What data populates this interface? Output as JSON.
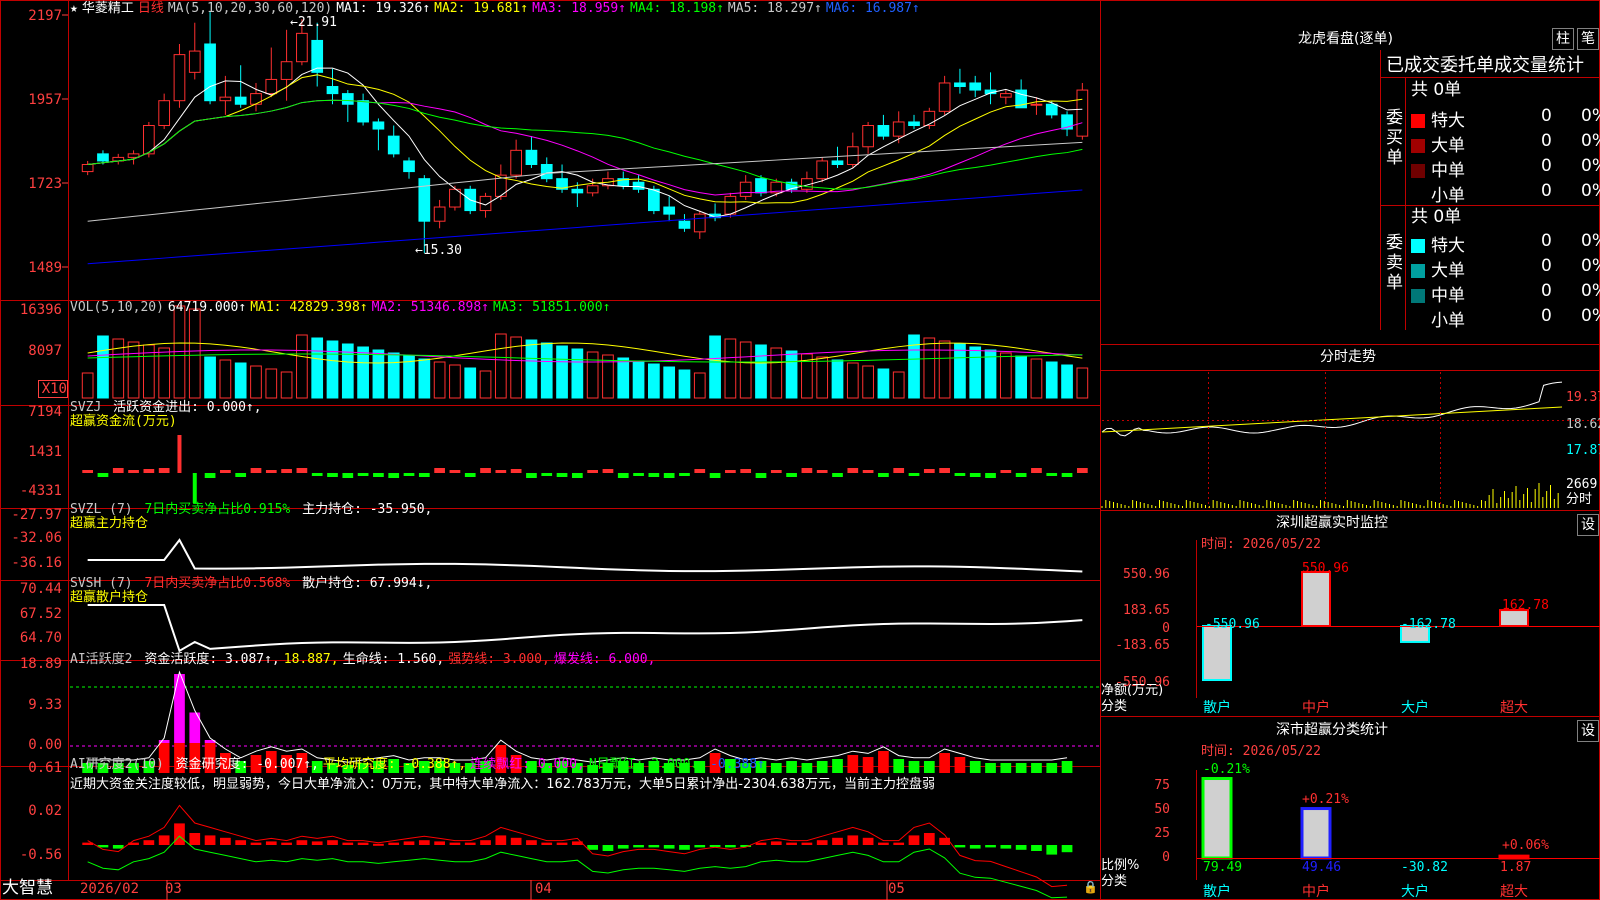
{
  "main_header": {
    "stock_name": "华菱精工",
    "period": "日线",
    "ma_label": "MA(5,10,20,30,60,120)",
    "ma1": "MA1: 19.326↑",
    "ma2": "MA2: 19.681↑",
    "ma3": "MA3: 18.959↑",
    "ma4": "MA4: 18.198↑",
    "ma5": "MA5: 18.297↑",
    "ma6": "MA6: 16.987↑",
    "high_marker": "21.91",
    "low_marker": "15.30"
  },
  "price_axis": [
    "2197",
    "1957",
    "1723",
    "1489"
  ],
  "vol_header": {
    "label": "VOL(5,10,20)",
    "v": "64719.000↑",
    "ma1": "MA1: 42829.398↑",
    "ma2": "MA2: 51346.898↑",
    "ma3": "MA3: 51851.000↑"
  },
  "vol_axis": [
    "16396",
    "8097",
    "X10"
  ],
  "svzj_header": {
    "label": "SVZJ",
    "t1": "活跃资金进出: 0.000↑,",
    "t2": "超赢资金流(万元)"
  },
  "svzj_axis": [
    "7194",
    "1431",
    "-4331"
  ],
  "svzl_header": {
    "label": "SVZL (7)",
    "t1": "7日内买卖净占比0.915%",
    "t2": "主力持仓: -35.950,",
    "t3": "超赢主力持仓"
  },
  "svzl_axis": [
    "-27.97",
    "-32.06",
    "-36.16"
  ],
  "svsh_header": {
    "label": "SVSH (7)",
    "t1": "7日内买卖净占比0.568%",
    "t2": "散户持仓: 67.994↓,",
    "t3": "超赢散户持仓"
  },
  "svsh_axis": [
    "70.44",
    "67.52",
    "64.70"
  ],
  "ai1_header": {
    "label": "AI活跃度2",
    "t1": "资金活跃度: 3.087↑,",
    "t2": "18.887,",
    "t3": "生命线: 1.560,",
    "t4": "强势线: 3.000,",
    "t5": "爆发线: 6.000,"
  },
  "ai1_axis": [
    "18.89",
    "9.33",
    "0.00"
  ],
  "ai2_header": {
    "label": "AI研究度2(10)",
    "t1": "资金研究度: -0.007↑,",
    "t2": "平均研究度: -0.388↑,",
    "t3": "连续飘红: 0.000,",
    "t4": "N日飘红: 2.000↓,",
    "t5": "-0.388↑"
  },
  "ai2_axis": [
    "0.61",
    "0.02",
    "-0.56"
  ],
  "ai2_comment": "近期大资金关注度较低，明显弱势，今日大单净流入：0万元，其中特大单净流入：162.783万元，大单5日累计净出-2304.638万元，当前主力控盘弱",
  "bottom_axis": {
    "brand": "大智慧",
    "d1": "2026/02",
    "d2": "03",
    "d3": "04",
    "d4": "05"
  },
  "right": {
    "lhb_title": "龙虎看盘(逐单)",
    "btn_col": "柱",
    "btn_pen": "笔",
    "tabs": "已成交委托单成交量统计",
    "buy_label": "委买单",
    "sell_label": "委卖单",
    "buy_total": "共 0单",
    "sell_total": "共 0单",
    "buy_rows": [
      {
        "label": "特大",
        "v": "0",
        "p": "0%",
        "color": "#ff0000"
      },
      {
        "label": "大单",
        "v": "0",
        "p": "0%",
        "color": "#a00000"
      },
      {
        "label": "中单",
        "v": "0",
        "p": "0%",
        "color": "#700000"
      },
      {
        "label": "小单",
        "v": "0",
        "p": "0%",
        "color": "#000000"
      }
    ],
    "sell_rows": [
      {
        "label": "特大",
        "v": "0",
        "p": "0%",
        "color": "#00ffff"
      },
      {
        "label": "大单",
        "v": "0",
        "p": "0%",
        "color": "#00a0a0"
      },
      {
        "label": "中单",
        "v": "0",
        "p": "0%",
        "color": "#007878"
      },
      {
        "label": "小单",
        "v": "0",
        "p": "0%",
        "color": "#000000"
      }
    ],
    "fenshi_title": "分时走势",
    "fenshi_axis": [
      "19.37",
      "18.62",
      "17.87",
      "2669",
      "分时"
    ],
    "sz_monitor_title": "深圳超赢实时监控",
    "sz_time": "时间: 2026/05/22",
    "sz_btn": "设",
    "sz_axis": [
      "550.96",
      "183.65",
      "0",
      "-183.65",
      "-550.96"
    ],
    "sz_labels": {
      "a": "净额(万元)",
      "b": "分类"
    },
    "sz_values": [
      "-550.96",
      "550.96",
      "-162.78",
      "162.78"
    ],
    "sz_cats": [
      "散户",
      "中户",
      "大户",
      "超大"
    ],
    "class_title": "深市超赢分类统计",
    "class_time": "时间: 2026/05/22",
    "class_btn": "设",
    "class_axis": [
      "75",
      "50",
      "25",
      "0"
    ],
    "class_labels": {
      "a": "比例%",
      "b": "分类"
    },
    "class_top": [
      "-0.21%",
      "+0.21%",
      "",
      "+0.06%"
    ],
    "class_values": [
      "79.49",
      "49.46",
      "-30.82",
      "1.87"
    ],
    "class_cats": [
      "散户",
      "中户",
      "大户",
      "超大"
    ]
  },
  "colors": {
    "up": "#ff3030",
    "down": "#00ffff",
    "frame": "#c00000",
    "ma1": "#ffffff",
    "ma2": "#ffff00",
    "ma3": "#ff00ff",
    "ma4": "#00ff00",
    "ma5": "#c8c8c8",
    "ma6": "#0000ff"
  },
  "chart_data": {
    "type": "candlestick",
    "title": "华菱精工 日线",
    "ylim": [
      14.4,
      22.3
    ],
    "candles": [
      {
        "o": 17.6,
        "h": 17.9,
        "l": 17.5,
        "c": 17.8
      },
      {
        "o": 18.1,
        "h": 18.2,
        "l": 17.8,
        "c": 17.9
      },
      {
        "o": 17.9,
        "h": 18.1,
        "l": 17.8,
        "c": 18.0
      },
      {
        "o": 18.0,
        "h": 18.2,
        "l": 17.8,
        "c": 18.1
      },
      {
        "o": 18.1,
        "h": 19.0,
        "l": 18.0,
        "c": 18.9
      },
      {
        "o": 18.9,
        "h": 19.8,
        "l": 18.8,
        "c": 19.6
      },
      {
        "o": 19.6,
        "h": 21.2,
        "l": 19.4,
        "c": 20.9
      },
      {
        "o": 20.4,
        "h": 21.8,
        "l": 20.2,
        "c": 21.0
      },
      {
        "o": 21.2,
        "h": 22.1,
        "l": 19.5,
        "c": 19.6
      },
      {
        "o": 19.6,
        "h": 20.3,
        "l": 19.2,
        "c": 19.7
      },
      {
        "o": 19.7,
        "h": 20.6,
        "l": 19.4,
        "c": 19.5
      },
      {
        "o": 19.5,
        "h": 20.1,
        "l": 19.3,
        "c": 19.8
      },
      {
        "o": 19.8,
        "h": 21.1,
        "l": 19.7,
        "c": 20.2
      },
      {
        "o": 20.2,
        "h": 21.6,
        "l": 19.6,
        "c": 20.7
      },
      {
        "o": 20.7,
        "h": 21.9,
        "l": 20.6,
        "c": 21.5
      },
      {
        "o": 21.3,
        "h": 21.8,
        "l": 20.0,
        "c": 20.4
      },
      {
        "o": 20.0,
        "h": 20.5,
        "l": 19.5,
        "c": 19.8
      },
      {
        "o": 19.8,
        "h": 19.9,
        "l": 19.0,
        "c": 19.5
      },
      {
        "o": 19.6,
        "h": 19.8,
        "l": 18.9,
        "c": 19.0
      },
      {
        "o": 19.0,
        "h": 19.1,
        "l": 18.2,
        "c": 18.8
      },
      {
        "o": 18.6,
        "h": 18.9,
        "l": 18.0,
        "c": 18.1
      },
      {
        "o": 17.9,
        "h": 18.0,
        "l": 17.4,
        "c": 17.6
      },
      {
        "o": 17.4,
        "h": 17.5,
        "l": 15.3,
        "c": 16.2
      },
      {
        "o": 16.2,
        "h": 16.8,
        "l": 16.0,
        "c": 16.6
      },
      {
        "o": 16.6,
        "h": 17.2,
        "l": 16.5,
        "c": 17.1
      },
      {
        "o": 17.1,
        "h": 17.2,
        "l": 16.4,
        "c": 16.5
      },
      {
        "o": 16.5,
        "h": 17.0,
        "l": 16.3,
        "c": 16.9
      },
      {
        "o": 16.9,
        "h": 17.8,
        "l": 16.8,
        "c": 17.5
      },
      {
        "o": 17.5,
        "h": 18.5,
        "l": 17.4,
        "c": 18.2
      },
      {
        "o": 18.2,
        "h": 18.6,
        "l": 17.7,
        "c": 17.8
      },
      {
        "o": 17.8,
        "h": 18.0,
        "l": 17.3,
        "c": 17.4
      },
      {
        "o": 17.4,
        "h": 17.8,
        "l": 17.0,
        "c": 17.1
      },
      {
        "o": 17.1,
        "h": 17.3,
        "l": 16.6,
        "c": 17.0
      },
      {
        "o": 17.0,
        "h": 17.4,
        "l": 16.9,
        "c": 17.2
      },
      {
        "o": 17.2,
        "h": 17.6,
        "l": 17.1,
        "c": 17.4
      },
      {
        "o": 17.4,
        "h": 17.6,
        "l": 17.1,
        "c": 17.2
      },
      {
        "o": 17.3,
        "h": 17.5,
        "l": 17.0,
        "c": 17.1
      },
      {
        "o": 17.1,
        "h": 17.2,
        "l": 16.4,
        "c": 16.5
      },
      {
        "o": 16.6,
        "h": 16.9,
        "l": 16.2,
        "c": 16.4
      },
      {
        "o": 16.2,
        "h": 16.4,
        "l": 15.9,
        "c": 16.0
      },
      {
        "o": 15.9,
        "h": 16.5,
        "l": 15.7,
        "c": 16.4
      },
      {
        "o": 16.4,
        "h": 16.7,
        "l": 16.2,
        "c": 16.3
      },
      {
        "o": 16.4,
        "h": 17.0,
        "l": 16.3,
        "c": 16.9
      },
      {
        "o": 16.9,
        "h": 17.5,
        "l": 16.8,
        "c": 17.3
      },
      {
        "o": 17.4,
        "h": 17.5,
        "l": 16.9,
        "c": 17.0
      },
      {
        "o": 17.0,
        "h": 17.4,
        "l": 16.9,
        "c": 17.3
      },
      {
        "o": 17.3,
        "h": 17.4,
        "l": 17.0,
        "c": 17.1
      },
      {
        "o": 17.1,
        "h": 17.6,
        "l": 17.0,
        "c": 17.4
      },
      {
        "o": 17.4,
        "h": 18.0,
        "l": 17.3,
        "c": 17.9
      },
      {
        "o": 17.9,
        "h": 18.3,
        "l": 17.7,
        "c": 17.8
      },
      {
        "o": 17.8,
        "h": 18.7,
        "l": 17.7,
        "c": 18.3
      },
      {
        "o": 18.3,
        "h": 19.0,
        "l": 18.1,
        "c": 18.9
      },
      {
        "o": 18.9,
        "h": 19.2,
        "l": 18.5,
        "c": 18.6
      },
      {
        "o": 18.6,
        "h": 19.3,
        "l": 18.4,
        "c": 19.0
      },
      {
        "o": 19.0,
        "h": 19.2,
        "l": 18.8,
        "c": 18.9
      },
      {
        "o": 18.9,
        "h": 19.4,
        "l": 18.8,
        "c": 19.3
      },
      {
        "o": 19.3,
        "h": 20.3,
        "l": 19.2,
        "c": 20.1
      },
      {
        "o": 20.1,
        "h": 20.5,
        "l": 19.8,
        "c": 20.0
      },
      {
        "o": 20.1,
        "h": 20.3,
        "l": 19.7,
        "c": 19.9
      },
      {
        "o": 19.9,
        "h": 20.4,
        "l": 19.5,
        "c": 19.8
      },
      {
        "o": 19.7,
        "h": 19.9,
        "l": 19.5,
        "c": 19.8
      },
      {
        "o": 19.9,
        "h": 20.2,
        "l": 19.4,
        "c": 19.4
      },
      {
        "o": 19.5,
        "h": 19.7,
        "l": 19.2,
        "c": 19.5
      },
      {
        "o": 19.5,
        "h": 19.6,
        "l": 19.1,
        "c": 19.2
      },
      {
        "o": 19.2,
        "h": 19.3,
        "l": 18.6,
        "c": 18.8
      },
      {
        "o": 18.6,
        "h": 20.1,
        "l": 18.5,
        "c": 19.9
      }
    ]
  }
}
